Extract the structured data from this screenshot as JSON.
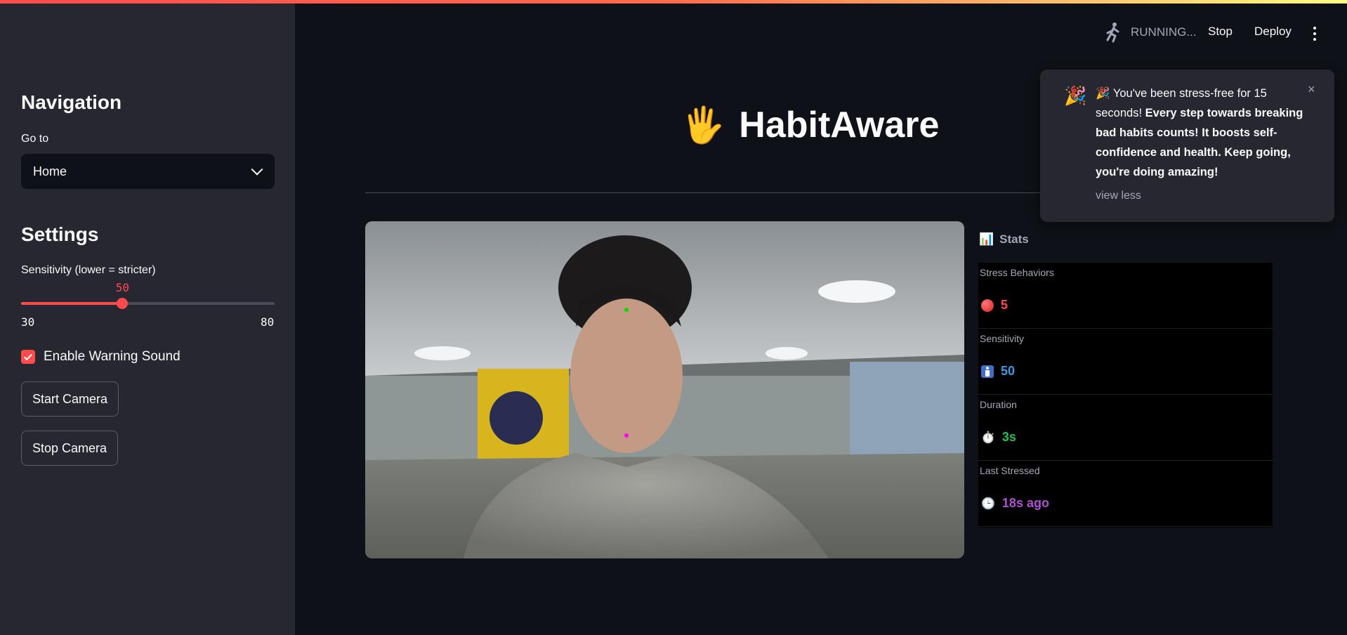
{
  "sidebar": {
    "nav_title": "Navigation",
    "goto_label": "Go to",
    "goto_value": "Home",
    "settings_title": "Settings",
    "sensitivity_label": "Sensitivity (lower = stricter)",
    "sensitivity_value": 50,
    "sensitivity_value_text": "50",
    "sensitivity_min": "30",
    "sensitivity_max": "80",
    "warning_sound_label": "Enable Warning Sound",
    "warning_sound_checked": true,
    "start_camera_label": "Start Camera",
    "stop_camera_label": "Stop Camera"
  },
  "header": {
    "status": "RUNNING...",
    "stop_label": "Stop",
    "deploy_label": "Deploy"
  },
  "main": {
    "title_icon": "🖐",
    "title": "HabitAware"
  },
  "stats": {
    "title": "Stats",
    "title_icon": "📊",
    "items": [
      {
        "label": "Stress Behaviors",
        "icon": "🔴",
        "value": "5",
        "color": "#ff4b4b"
      },
      {
        "label": "Sensitivity",
        "icon": "🚹",
        "value": "50",
        "color": "#3b9ae1"
      },
      {
        "label": "Duration",
        "icon": "⏱️",
        "value": "3s",
        "color": "#21c354"
      },
      {
        "label": "Last Stressed",
        "icon": "🕒",
        "value": "18s ago",
        "color": "#b04fd6"
      }
    ]
  },
  "toast": {
    "icon": "🎉",
    "emoji": "🎉",
    "plain": "You've been stress-free for 15 seconds!",
    "bold": "Every step towards breaking bad habits counts! It boosts self-confidence and health. Keep going, you're doing amazing!",
    "more_label": "view less",
    "close": "×"
  },
  "colors": {
    "accent": "#ff4b4b",
    "background": "#0e1117",
    "sidebar": "#262730"
  }
}
